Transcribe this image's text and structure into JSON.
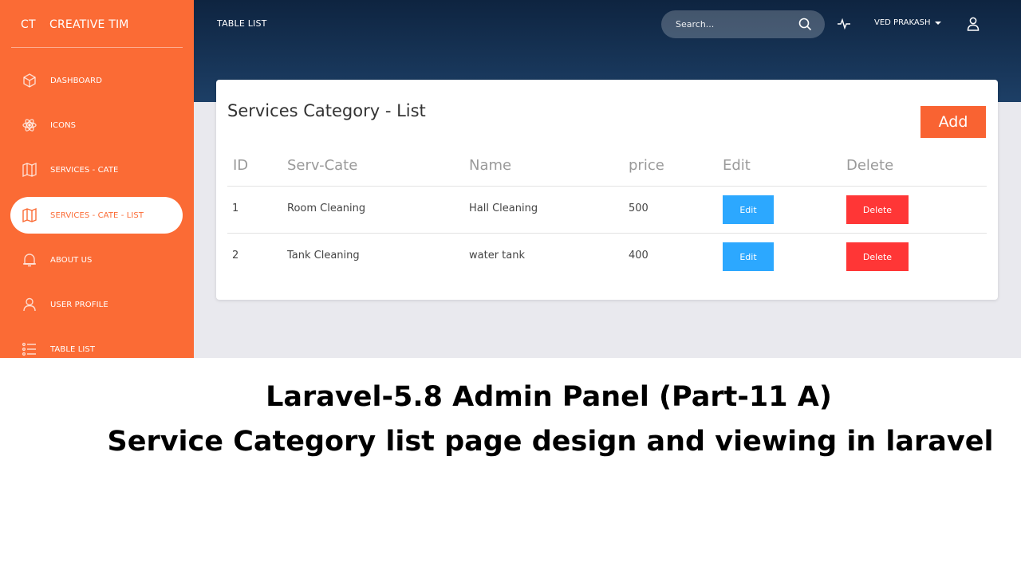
{
  "sidebar": {
    "brand_mini": "CT",
    "brand_name": "CREATIVE TIM",
    "items": [
      {
        "label": "DASHBOARD",
        "icon": "cube-icon"
      },
      {
        "label": "ICONS",
        "icon": "atom-icon"
      },
      {
        "label": "SERVICES - CATE",
        "icon": "map-icon"
      },
      {
        "label": "SERVICES - CATE - LIST",
        "icon": "map-icon",
        "active": true
      },
      {
        "label": "ABOUT US",
        "icon": "bell-icon"
      },
      {
        "label": "USER PROFILE",
        "icon": "user-icon"
      },
      {
        "label": "TABLE LIST",
        "icon": "list-icon"
      }
    ]
  },
  "header": {
    "page_title": "TABLE LIST",
    "search_placeholder": "Search...",
    "user_name": "VED PRAKASH"
  },
  "card": {
    "title": "Services Category - List",
    "add_label": "Add",
    "columns": [
      "ID",
      "Serv-Cate",
      "Name",
      "price",
      "Edit",
      "Delete"
    ],
    "rows": [
      {
        "id": "1",
        "cate": "Room Cleaning",
        "name": "Hall Cleaning",
        "price": "500",
        "edit": "Edit",
        "delete": "Delete"
      },
      {
        "id": "2",
        "cate": "Tank Cleaning",
        "name": "water tank",
        "price": "400",
        "edit": "Edit",
        "delete": "Delete"
      }
    ]
  },
  "caption": {
    "line1": "Laravel-5.8 Admin Panel (Part-11 A)",
    "line2": "Service Category list page design and viewing in laravel"
  },
  "colors": {
    "sidebar": "#fb6b35",
    "header_top": "#0e2440",
    "add_button": "#f96332",
    "edit_button": "#2ca8ff",
    "delete_button": "#ff3636"
  }
}
